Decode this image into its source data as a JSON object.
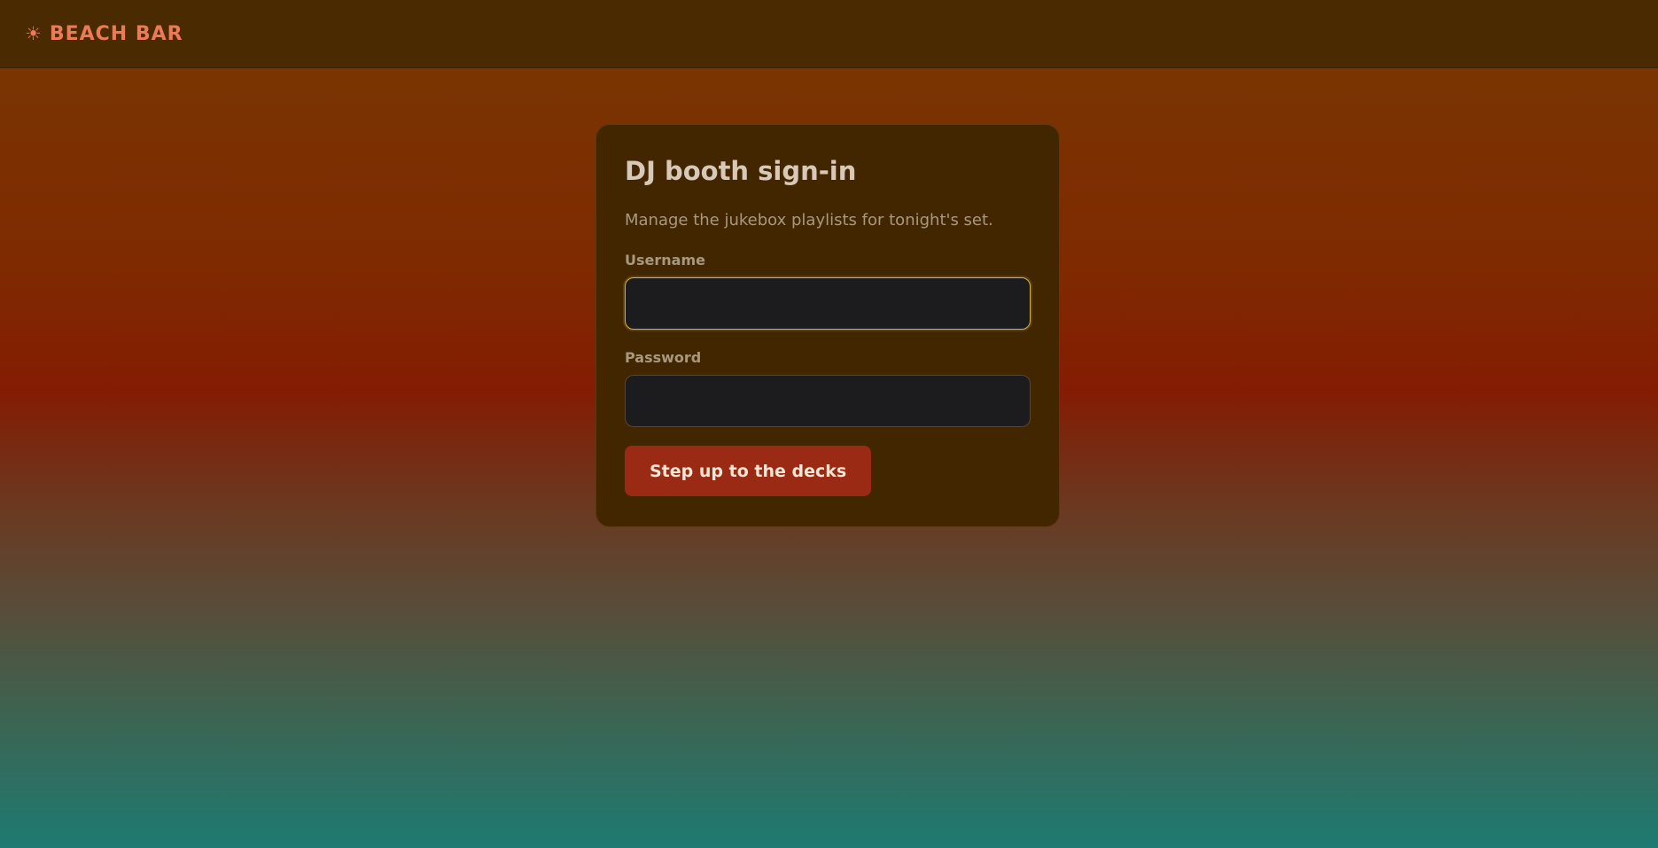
{
  "header": {
    "brand_icon": "sun-icon",
    "brand_name": "BEACH BAR"
  },
  "login": {
    "title": "DJ booth sign-in",
    "subtitle": "Manage the jukebox playlists for tonight's set.",
    "username": {
      "label": "Username",
      "value": "",
      "placeholder": ""
    },
    "password": {
      "label": "Password",
      "value": "",
      "placeholder": ""
    },
    "submit_label": "Step up to the decks"
  },
  "colors": {
    "brand": "#ec7a55",
    "card_background": "#422600",
    "button": "#9a2a14",
    "focus_ring": "#d9b040"
  }
}
